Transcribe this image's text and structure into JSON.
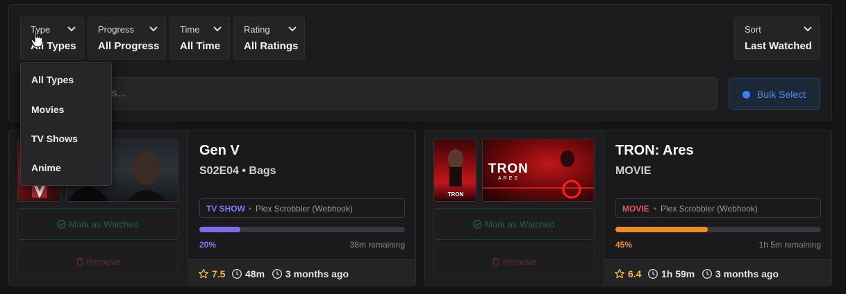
{
  "filters": [
    {
      "label": "Type",
      "value": "All Types"
    },
    {
      "label": "Progress",
      "value": "All Progress"
    },
    {
      "label": "Time",
      "value": "All Time"
    },
    {
      "label": "Rating",
      "value": "All Ratings"
    }
  ],
  "sort": {
    "label": "Sort",
    "value": "Last Watched"
  },
  "search": {
    "placeholder": "s, episodes, apps..."
  },
  "bulk_select": {
    "label": "Bulk Select"
  },
  "type_dropdown": {
    "options": [
      "All Types",
      "Movies",
      "TV Shows",
      "Anime"
    ]
  },
  "cards": [
    {
      "title": "Gen V",
      "subtitle": "S02E04 • Bags",
      "type_badge": "TV SHOW",
      "source": "Plex Scrobbler (Webhook)",
      "progress": 0.2,
      "progress_label": "20%",
      "remaining": "38m remaining",
      "rating": "7.5",
      "runtime": "48m",
      "last_watched": "3 months ago",
      "mark_label": "Mark as Watched",
      "remove_label": "Remove",
      "badge_color": "#7b7bf5",
      "bar_color": "#7b6cf0"
    },
    {
      "title": "TRON: Ares",
      "subtitle": "MOVIE",
      "type_badge": "MOVIE",
      "source": "Plex Scrobbler (Webhook)",
      "progress": 0.45,
      "progress_label": "45%",
      "remaining": "1h 5m remaining",
      "rating": "6.4",
      "runtime": "1h 59m",
      "last_watched": "3 months ago",
      "mark_label": "Mark as Watched",
      "remove_label": "Remove",
      "poster_text": "TRON",
      "backdrop_title": "TRON",
      "backdrop_subtitle": "ARES",
      "badge_color": "#e05a5a",
      "bar_color": "#f08a24"
    }
  ],
  "colors": {
    "accent": "#3b82f6",
    "star": "#f5b942"
  }
}
